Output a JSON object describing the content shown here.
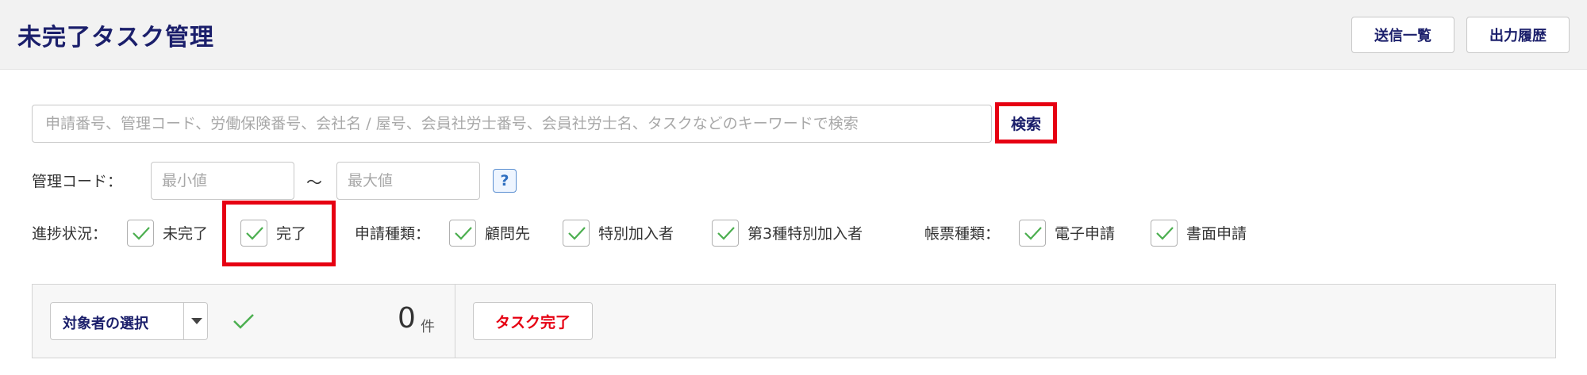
{
  "header": {
    "title": "未完了タスク管理",
    "send_list_label": "送信一覧",
    "output_history_label": "出力履歴"
  },
  "search": {
    "placeholder": "申請番号、管理コード、労働保険番号、会社名 / 屋号、会員社労士番号、会員社労士名、タスクなどのキーワードで検索",
    "value": "",
    "button_label": "検索"
  },
  "filters": {
    "management_code": {
      "label": "管理コード：",
      "min_placeholder": "最小値",
      "max_placeholder": "最大値",
      "separator": "〜",
      "help_label": "?"
    },
    "progress": {
      "label": "進捗状況：",
      "options": [
        {
          "label": "未完了",
          "checked": true
        },
        {
          "label": "完了",
          "checked": true
        }
      ]
    },
    "application_type": {
      "label": "申請種類：",
      "options": [
        {
          "label": "顧問先",
          "checked": true
        },
        {
          "label": "特別加入者",
          "checked": true
        },
        {
          "label": "第3種特別加入者",
          "checked": true
        }
      ]
    },
    "form_type": {
      "label": "帳票種類：",
      "options": [
        {
          "label": "電子申請",
          "checked": true
        },
        {
          "label": "書面申請",
          "checked": true
        }
      ]
    }
  },
  "action_panel": {
    "select_label": "対象者の選択",
    "count": "0",
    "count_unit": "件",
    "task_complete_label": "タスク完了"
  },
  "colors": {
    "title": "#1b1f6b",
    "highlight": "#e60012",
    "check": "#4caf50",
    "danger_text": "#e60012"
  }
}
